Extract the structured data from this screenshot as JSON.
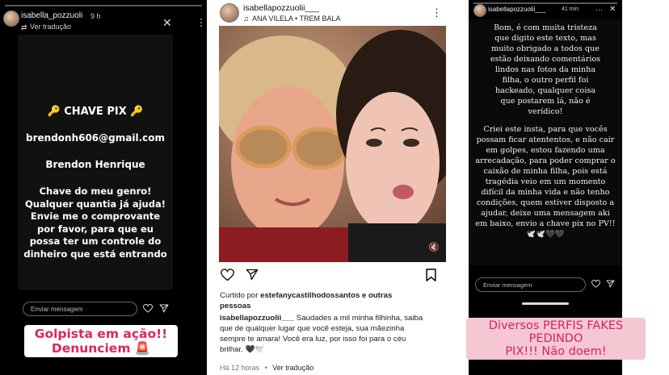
{
  "story1": {
    "username": "isabella_pozzuoli",
    "time": "9 h",
    "translation": "Ver tradução",
    "title": "🔑 CHAVE PIX 🔑",
    "email": "brendonh606@gmail.com",
    "name": "Brendon Henrique",
    "message_lines": [
      "Chave do meu genro!",
      "Qualquer quantia já ajuda!",
      "Envie me o comprovante",
      "por favor, para que eu",
      "possa ter um controle do",
      "dinheiro que está entrando"
    ],
    "reply_placeholder": "Enviar mensagem",
    "sticker_lines": [
      "Golpista em ação!!",
      "Denunciem 🚨"
    ],
    "sticker_color": "#e0245e"
  },
  "post": {
    "username": "isabellapozzuolii___",
    "music": "ANA VILELA • TREM BALA",
    "liked_by_prefix": "Curtido por ",
    "liked_by_user": "estefanycastilhodossantos",
    "liked_by_suffix": " e outras",
    "liked_by_line2": "pessoas",
    "caption_user": "isabellapozzuolii___",
    "caption_lines": [
      " Saudades a mil minha filhinha, saiba",
      "que de qualquer lugar que você esteja, sua mãezinha",
      "sempre te amara! Você era luz, por isso foi para o céu",
      "brilhar. 🖤🕊️"
    ],
    "time": "Há 12 horas",
    "translation": "Ver tradução"
  },
  "story3": {
    "username": "isabellapozzuolii___",
    "time": "41 min",
    "message_lines": [
      "Bom, é  com muita tristeza",
      "que digito este texto, mas",
      "muito obrigado a todos que",
      "estão deixando comentários",
      "lindos nas fotos da minha",
      "filha, o outro perfil foi",
      "hackeado, qualquer coisa",
      "que postarem lá, não é",
      "verídico!",
      "",
      "Criei este insta, para que vocês",
      "possam ficar atententos, e não cair",
      "em golpes, estou fazendo uma",
      "arrecadação, para poder comprar o",
      "caixão de minha filha, pois está",
      "tragédia veio em um momento",
      "difícil da minha vida e não tenho",
      "condições, quem estiver disposto a",
      "ajudar, deixe uma mensagem aki",
      "em baixo, envio a chave pix no PV!!",
      "🕊️🕊️🖤🖤"
    ],
    "reply_placeholder": "Enviar mensagem",
    "sticker_lines": [
      "Diversos PERFIS FAKES PEDINDO",
      "PIX!!! Não doem!"
    ],
    "sticker_color": "#d8206a"
  }
}
